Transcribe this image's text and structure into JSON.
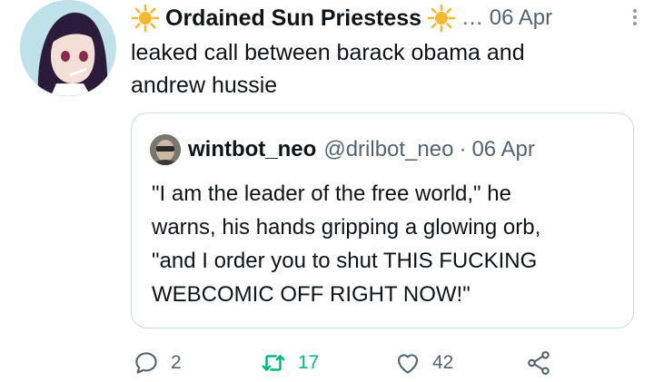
{
  "tweet": {
    "display_name": "Ordained Sun Priestess",
    "meta": "… 06 Apr",
    "text_line1": "leaked call between barack obama and",
    "text_line2": "andrew hussie"
  },
  "quote": {
    "name": "wintbot_neo",
    "handle": "@drilbot_neo",
    "separator": "·",
    "date": "06 Apr",
    "line1": "\"I am the leader of the free world,\" he",
    "line2": "warns, his hands gripping a glowing orb,",
    "line3": "\"and I order you to shut THIS FUCKING",
    "line4": "WEBCOMIC OFF RIGHT NOW!\""
  },
  "actions": {
    "reply_count": "2",
    "retweet_count": "17",
    "like_count": "42"
  },
  "icons": {
    "name_emoji": "sun-icon",
    "more": "more-vertical-icon",
    "reply": "reply-icon",
    "retweet": "retweet-icon",
    "like": "heart-icon",
    "share": "share-icon"
  },
  "colors": {
    "text": "#0f1419",
    "secondary": "#536471",
    "retweet_green": "#00ba7c",
    "border": "#cfd9de",
    "sun": "#f5b82e"
  }
}
